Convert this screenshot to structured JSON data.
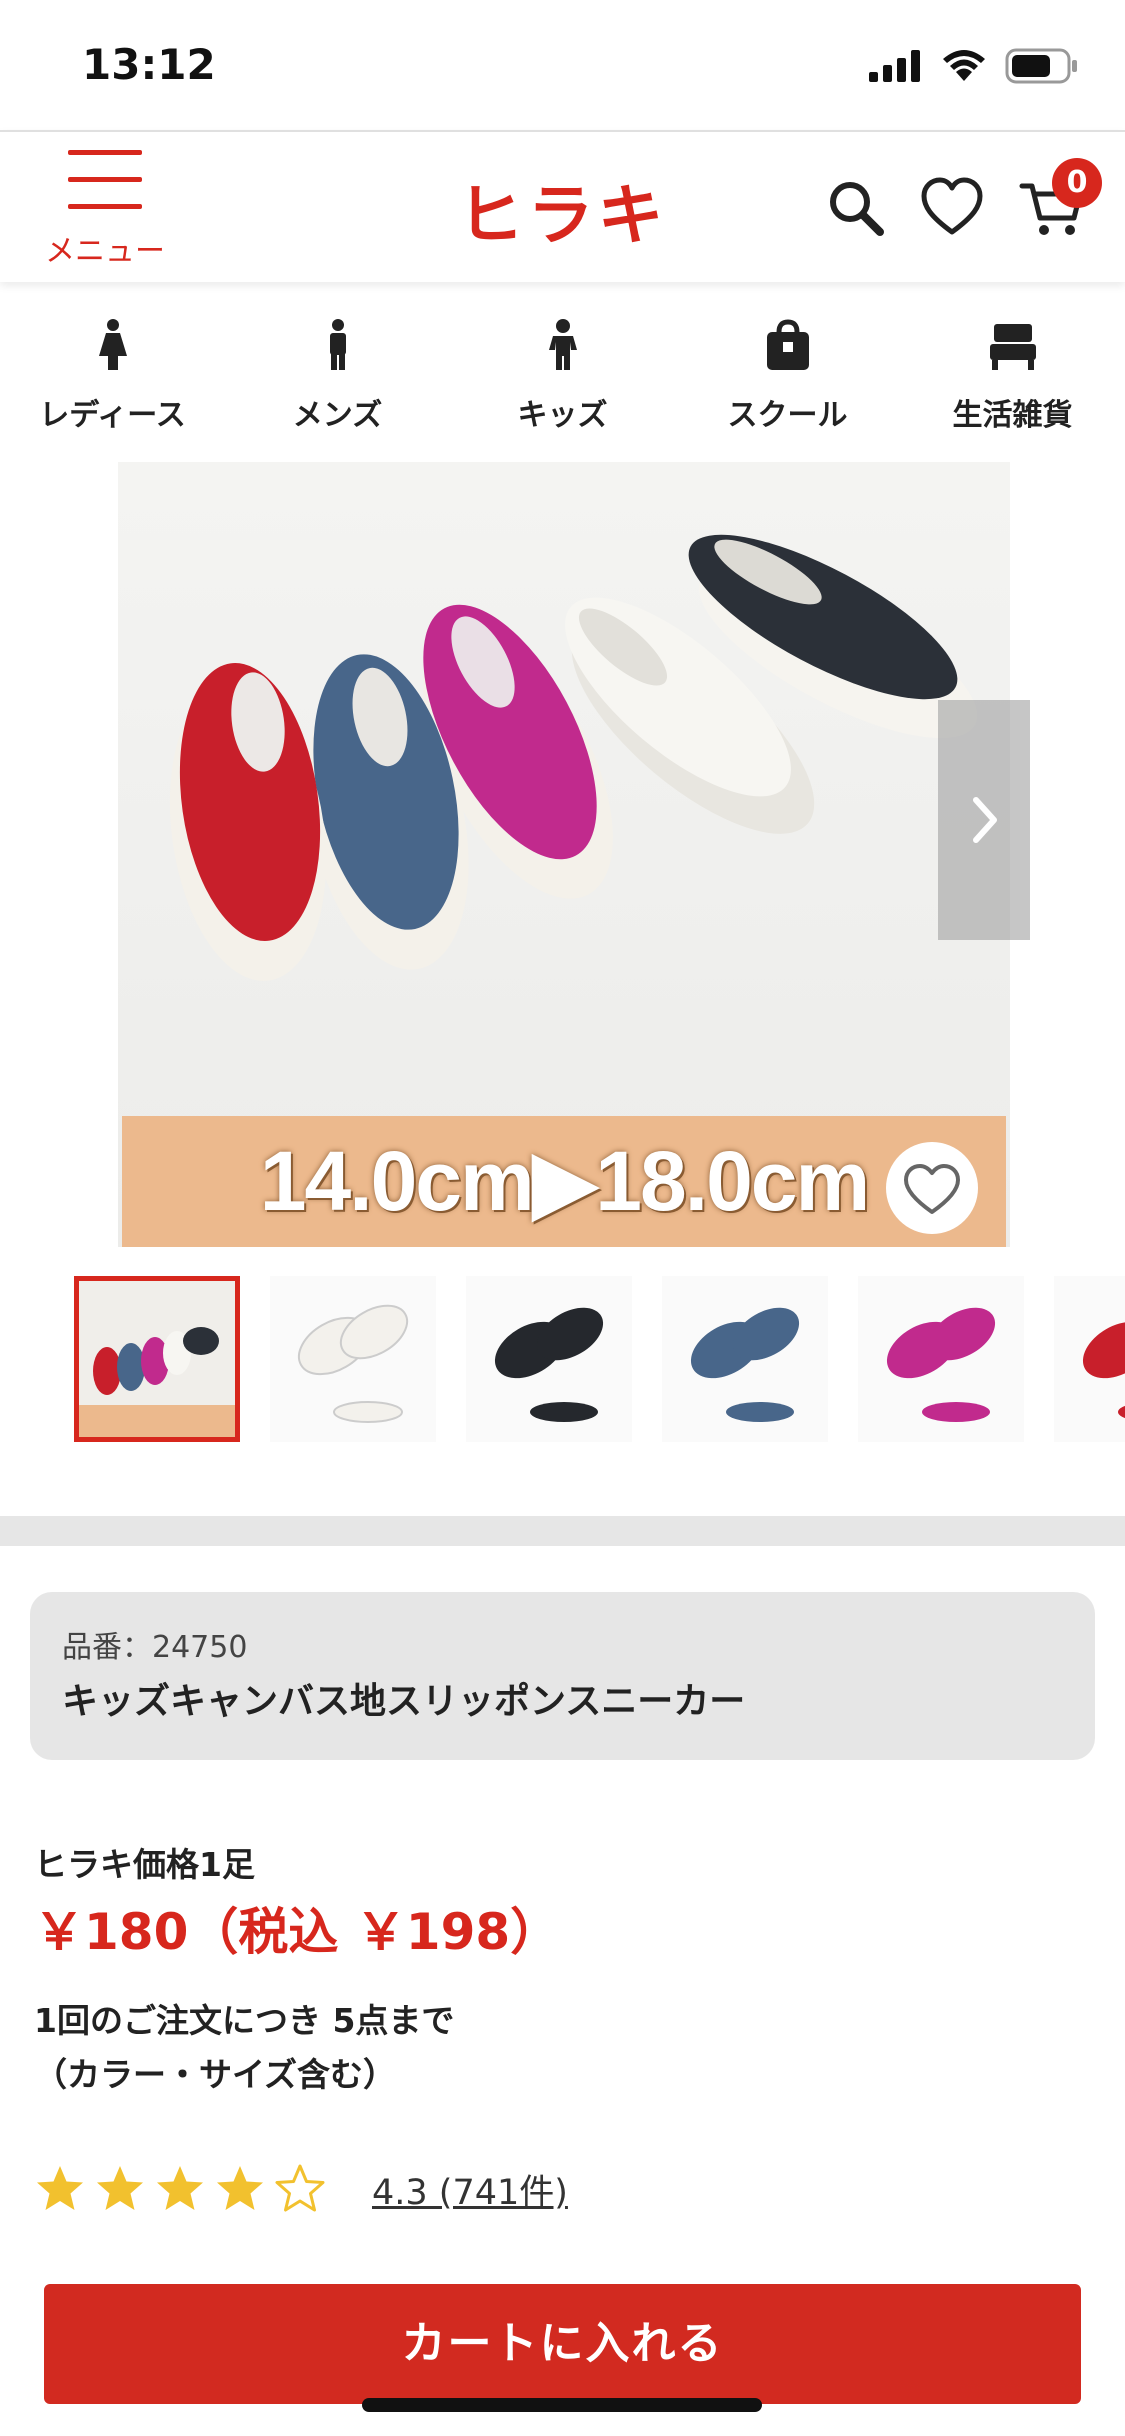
{
  "status_bar": {
    "time": "13:12"
  },
  "header": {
    "menu_label": "メニュー",
    "logo": "ヒラキ",
    "cart_count": "0",
    "icons": [
      "search-icon",
      "heart-icon",
      "cart-icon"
    ]
  },
  "categories": [
    {
      "label": "レディース",
      "icon": "woman-icon"
    },
    {
      "label": "メンズ",
      "icon": "man-icon"
    },
    {
      "label": "キッズ",
      "icon": "child-icon"
    },
    {
      "label": "スクール",
      "icon": "school-bag-icon"
    },
    {
      "label": "生活雑貨",
      "icon": "bed-icon"
    }
  ],
  "hero": {
    "size_range": "14.0cm▶18.0cm",
    "shoe_colors": [
      "#c81f2b",
      "#48668a",
      "#c12a8d",
      "#f3f1ec",
      "#2b3038"
    ]
  },
  "thumbnails": [
    {
      "colors": [
        "#c81f2b",
        "#48668a",
        "#c12a8d",
        "#f3f1ec",
        "#2b3038"
      ],
      "selected": true
    },
    {
      "colors": [
        "#f3f1ec"
      ]
    },
    {
      "colors": [
        "#25282d"
      ]
    },
    {
      "colors": [
        "#48668a"
      ]
    },
    {
      "colors": [
        "#c12a8d"
      ]
    },
    {
      "colors": [
        "#c81f2b"
      ]
    }
  ],
  "product": {
    "number": "品番：24750",
    "name": "キッズキャンバス地スリッポンスニーカー"
  },
  "price": {
    "label": "ヒラキ価格1足",
    "value": "￥180（税込 ￥198）"
  },
  "limit": {
    "line1": "1回のご注文につき 5点まで",
    "line2": "（カラー・サイズ含む）"
  },
  "rating": {
    "score": 4.3,
    "text": "4.3 (741件)",
    "star_color": "#f2c12e"
  },
  "cart_button": {
    "label": "カートに入れる"
  },
  "colors": {
    "brand": "#d7271d"
  }
}
